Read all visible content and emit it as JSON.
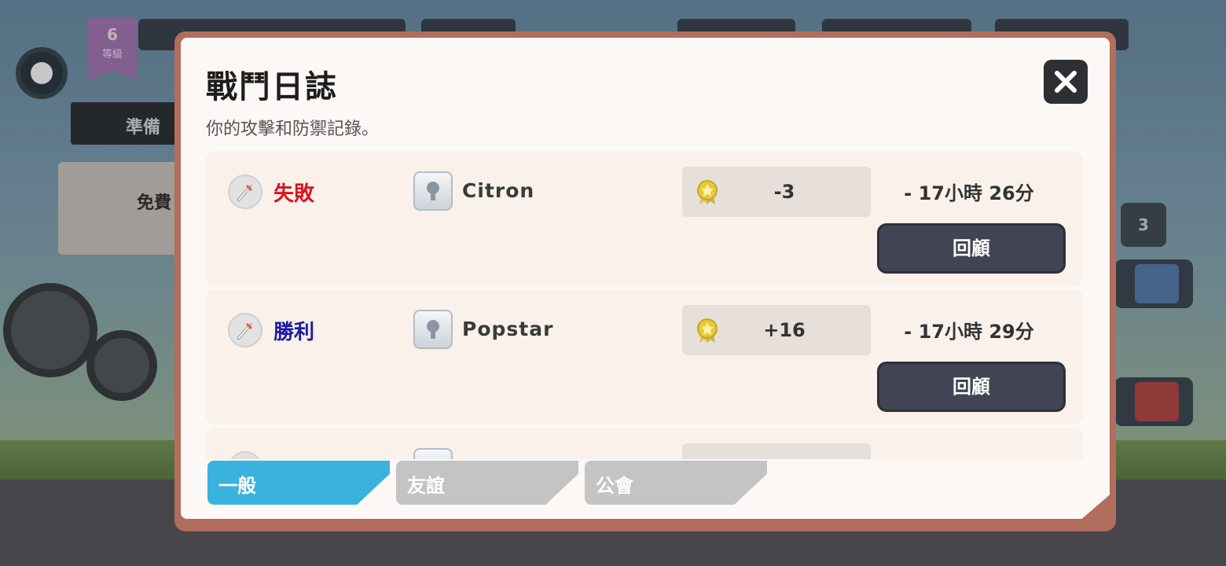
{
  "background": {
    "level_number": "6",
    "level_label": "等級",
    "side_banner_text": "準備",
    "side_card_text": "免費",
    "right_badge_count": "3"
  },
  "dialog": {
    "title": "戰鬥日誌",
    "subtitle": "你的攻擊和防禦記錄。",
    "close_icon": "close-icon"
  },
  "battles": [
    {
      "result": "失敗",
      "result_color": "#d9141e",
      "player": "Citron",
      "trophies": "-3",
      "time": "- 17小時 26分",
      "review_label": "回顧"
    },
    {
      "result": "勝利",
      "result_color": "#1a1aa6",
      "player": "Popstar",
      "trophies": "+16",
      "time": "- 17小時 29分",
      "review_label": "回顧"
    }
  ],
  "tabs": [
    {
      "label": "一般",
      "active": true
    },
    {
      "label": "友誼",
      "active": false
    },
    {
      "label": "公會",
      "active": false
    }
  ],
  "colors": {
    "tab_active": "#3ab2de",
    "tab_inactive": "#c4c4c4",
    "review_button": "#414452",
    "dialog_border": "#b16e5c"
  }
}
